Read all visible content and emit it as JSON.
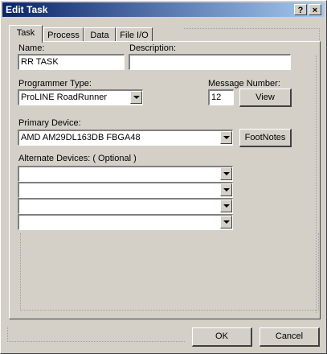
{
  "window": {
    "title": "Edit Task"
  },
  "title_buttons": {
    "help": "?",
    "close": "×"
  },
  "tabs": [
    {
      "label": "Task"
    },
    {
      "label": "Process"
    },
    {
      "label": "Data"
    },
    {
      "label": "File I/O"
    }
  ],
  "task": {
    "name_label": "Name:",
    "name_value": "RR TASK",
    "description_label": "Description:",
    "description_value": "",
    "programmer_type_label": "Programmer Type:",
    "programmer_type_value": "ProLINE RoadRunner",
    "message_number_label": "Message Number:",
    "message_number_value": "12",
    "view_button": "View",
    "primary_device_label": "Primary Device:",
    "primary_device_value": "AMD AM29DL163DB FBGA48",
    "footnotes_button": "FootNotes",
    "alternate_devices_label": "Alternate Devices:  ( Optional )",
    "alternate_devices": [
      "",
      "",
      "",
      ""
    ]
  },
  "footer": {
    "ok_button": "OK",
    "cancel_button": "Cancel"
  }
}
